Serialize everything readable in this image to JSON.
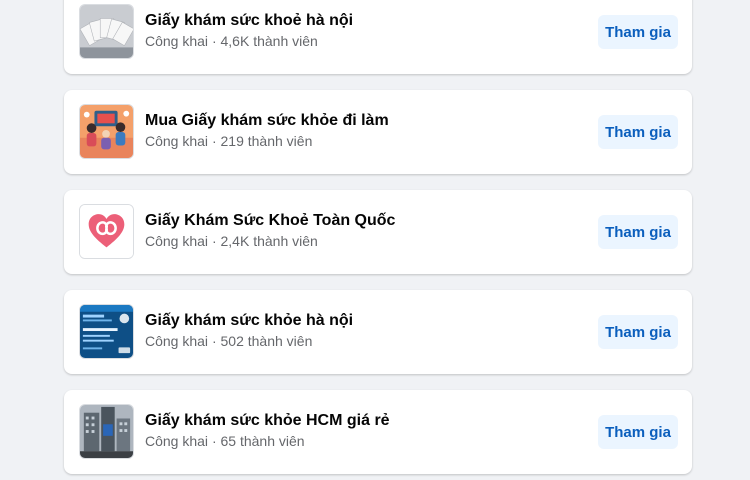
{
  "groups": [
    {
      "name": "Giấy khám sức khoẻ hà nội",
      "privacy": "Công khai",
      "members": "4,6K thành viên",
      "join_label": "Tham gia",
      "thumb_icon": "fanned-documents-thumbnail"
    },
    {
      "name": "Mua Giấy khám sức khỏe đi làm",
      "privacy": "Công khai",
      "members": "219 thành viên",
      "join_label": "Tham gia",
      "thumb_icon": "people-illustration-thumbnail"
    },
    {
      "name": "Giấy Khám Sức Khoẻ Toàn Quốc",
      "privacy": "Công khai",
      "members": "2,4K thành viên",
      "join_label": "Tham gia",
      "thumb_icon": "heart-logo-thumbnail"
    },
    {
      "name": "Giấy khám sức khỏe hà nội",
      "privacy": "Công khai",
      "members": "502 thành viên",
      "join_label": "Tham gia",
      "thumb_icon": "blue-banner-thumbnail"
    },
    {
      "name": "Giấy khám sức khỏe HCM giá rẻ",
      "privacy": "Công khai",
      "members": "65 thành viên",
      "join_label": "Tham gia",
      "thumb_icon": "building-photo-thumbnail"
    }
  ],
  "separator": "·",
  "colors": {
    "page_background": "#f0f2f5",
    "card_background": "#ffffff",
    "join_button_background": "#ebf5ff",
    "join_button_text": "#0b5fbd",
    "meta_text": "#65676b"
  }
}
